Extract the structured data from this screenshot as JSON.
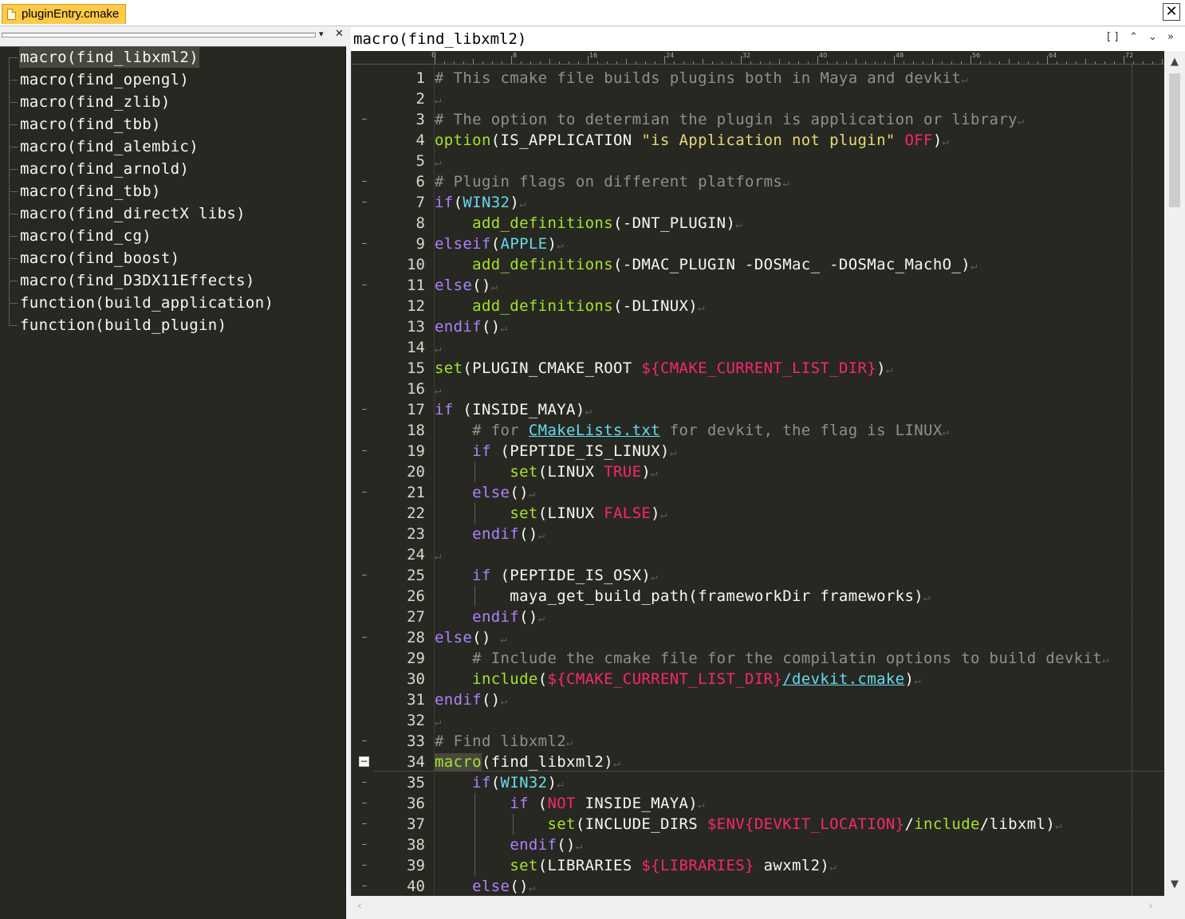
{
  "tab": {
    "label": "pluginEntry.cmake",
    "close_label": "✕"
  },
  "outline": {
    "dropdown_label": "▾",
    "close_label": "✕",
    "items": [
      "macro(find_libxml2)",
      "macro(find_opengl)",
      "macro(find_zlib)",
      "macro(find_tbb)",
      "macro(find_alembic)",
      "macro(find_arnold)",
      "macro(find_tbb)",
      "macro(find_directX libs)",
      "macro(find_cg)",
      "macro(find_boost)",
      "macro(find_D3DX11Effects)",
      "function(build_application)",
      "function(build_plugin)"
    ],
    "selected_index": 0
  },
  "editor": {
    "title": "macro(find_libxml2)",
    "buttons": {
      "maximize": "[ ]",
      "prev": "⌃",
      "next": "⌄",
      "more": "»"
    },
    "ruler": {
      "start": "0",
      "marks": [
        "8",
        "16",
        "24",
        "32",
        "40",
        "48",
        "56",
        "64",
        "72"
      ]
    },
    "current_line": 34,
    "lines": [
      {
        "n": "1",
        "fold": "",
        "segs": [
          [
            "c-cm",
            "# This cmake file builds plugins both in Maya and devkit"
          ]
        ]
      },
      {
        "n": "2",
        "fold": "",
        "segs": []
      },
      {
        "n": "3",
        "fold": "–",
        "segs": [
          [
            "c-cm",
            "# The option to determian the plugin is application or library"
          ]
        ]
      },
      {
        "n": "4",
        "fold": "",
        "segs": [
          [
            "c-fn",
            "option"
          ],
          [
            "",
            "(IS_APPLICATION "
          ],
          [
            "c-str",
            "\"is Application not plugin\""
          ],
          [
            "",
            " "
          ],
          [
            "c-vr",
            "OFF"
          ],
          [
            "",
            ")"
          ]
        ]
      },
      {
        "n": "5",
        "fold": "",
        "segs": []
      },
      {
        "n": "6",
        "fold": "–",
        "segs": [
          [
            "c-cm",
            "# Plugin flags on different platforms"
          ]
        ]
      },
      {
        "n": "7",
        "fold": "–",
        "segs": [
          [
            "c-kw",
            "if"
          ],
          [
            "",
            "("
          ],
          [
            "c-bl",
            "WIN32"
          ],
          [
            "",
            ")"
          ]
        ]
      },
      {
        "n": "8",
        "fold": "",
        "segs": [
          [
            "",
            "    "
          ],
          [
            "c-fn",
            "add_definitions"
          ],
          [
            "",
            "(-DNT_PLUGIN)"
          ]
        ]
      },
      {
        "n": "9",
        "fold": "–",
        "segs": [
          [
            "c-kw",
            "elseif"
          ],
          [
            "",
            "("
          ],
          [
            "c-bl",
            "APPLE"
          ],
          [
            "",
            ")"
          ]
        ]
      },
      {
        "n": "10",
        "fold": "",
        "segs": [
          [
            "",
            "    "
          ],
          [
            "c-fn",
            "add_definitions"
          ],
          [
            "",
            "(-DMAC_PLUGIN -DOSMac_ -DOSMac_MachO_)"
          ]
        ]
      },
      {
        "n": "11",
        "fold": "–",
        "segs": [
          [
            "c-kw",
            "else"
          ],
          [
            "",
            "()"
          ]
        ]
      },
      {
        "n": "12",
        "fold": "",
        "segs": [
          [
            "",
            "    "
          ],
          [
            "c-fn",
            "add_definitions"
          ],
          [
            "",
            "(-DLINUX)"
          ]
        ]
      },
      {
        "n": "13",
        "fold": "",
        "segs": [
          [
            "c-kw",
            "endif"
          ],
          [
            "",
            "()"
          ]
        ]
      },
      {
        "n": "14",
        "fold": "",
        "segs": []
      },
      {
        "n": "15",
        "fold": "",
        "segs": [
          [
            "c-fn",
            "set"
          ],
          [
            "",
            "(PLUGIN_CMAKE_ROOT "
          ],
          [
            "c-vr",
            "${CMAKE_CURRENT_LIST_DIR}"
          ],
          [
            "",
            ")"
          ]
        ]
      },
      {
        "n": "16",
        "fold": "",
        "segs": []
      },
      {
        "n": "17",
        "fold": "–",
        "segs": [
          [
            "c-kw",
            "if"
          ],
          [
            "",
            " (INSIDE_MAYA)"
          ]
        ]
      },
      {
        "n": "18",
        "fold": "",
        "segs": [
          [
            "",
            "    "
          ],
          [
            "c-cm",
            "# for "
          ],
          [
            "c-bl u",
            "CMakeLists.txt"
          ],
          [
            "c-cm",
            " for devkit, the flag is LINUX"
          ]
        ]
      },
      {
        "n": "19",
        "fold": "–",
        "segs": [
          [
            "",
            "    "
          ],
          [
            "c-kw",
            "if"
          ],
          [
            "",
            " (PEPTIDE_IS_LINUX)"
          ]
        ]
      },
      {
        "n": "20",
        "fold": "",
        "segs": [
          [
            "",
            "        "
          ],
          [
            "c-fn",
            "set"
          ],
          [
            "",
            "(LINUX "
          ],
          [
            "c-vr",
            "TRUE"
          ],
          [
            "",
            ")"
          ]
        ]
      },
      {
        "n": "21",
        "fold": "–",
        "segs": [
          [
            "",
            "    "
          ],
          [
            "c-kw",
            "else"
          ],
          [
            "",
            "()"
          ]
        ]
      },
      {
        "n": "22",
        "fold": "",
        "segs": [
          [
            "",
            "        "
          ],
          [
            "c-fn",
            "set"
          ],
          [
            "",
            "(LINUX "
          ],
          [
            "c-vr",
            "FALSE"
          ],
          [
            "",
            ")"
          ]
        ]
      },
      {
        "n": "23",
        "fold": "",
        "segs": [
          [
            "",
            "    "
          ],
          [
            "c-kw",
            "endif"
          ],
          [
            "",
            "()"
          ]
        ]
      },
      {
        "n": "24",
        "fold": "",
        "segs": []
      },
      {
        "n": "25",
        "fold": "–",
        "segs": [
          [
            "",
            "    "
          ],
          [
            "c-kw",
            "if"
          ],
          [
            "",
            " (PEPTIDE_IS_OSX)"
          ]
        ]
      },
      {
        "n": "26",
        "fold": "",
        "segs": [
          [
            "",
            "        maya_get_build_path(frameworkDir frameworks)"
          ]
        ]
      },
      {
        "n": "27",
        "fold": "",
        "segs": [
          [
            "",
            "    "
          ],
          [
            "c-kw",
            "endif"
          ],
          [
            "",
            "()"
          ]
        ]
      },
      {
        "n": "28",
        "fold": "–",
        "segs": [
          [
            "c-kw",
            "else"
          ],
          [
            "",
            "() "
          ]
        ]
      },
      {
        "n": "29",
        "fold": "",
        "segs": [
          [
            "",
            "    "
          ],
          [
            "c-cm",
            "# Include the cmake file for the compilatin options to build devkit"
          ]
        ]
      },
      {
        "n": "30",
        "fold": "",
        "segs": [
          [
            "",
            "    "
          ],
          [
            "c-fn",
            "include"
          ],
          [
            "",
            "("
          ],
          [
            "c-vr",
            "${CMAKE_CURRENT_LIST_DIR}"
          ],
          [
            "c-bl u",
            "/devkit.cmake"
          ],
          [
            "",
            ")"
          ]
        ]
      },
      {
        "n": "31",
        "fold": "",
        "segs": [
          [
            "c-kw",
            "endif"
          ],
          [
            "",
            "()"
          ]
        ]
      },
      {
        "n": "32",
        "fold": "",
        "segs": []
      },
      {
        "n": "33",
        "fold": "–",
        "segs": [
          [
            "c-cm",
            "# Find libxml2"
          ]
        ]
      },
      {
        "n": "34",
        "fold": "box",
        "segs": [
          [
            "c-fn caret-box",
            "macro"
          ],
          [
            "",
            "(find_libxml2)"
          ]
        ]
      },
      {
        "n": "35",
        "fold": "–",
        "segs": [
          [
            "",
            "    "
          ],
          [
            "c-kw",
            "if"
          ],
          [
            "",
            "("
          ],
          [
            "c-bl",
            "WIN32"
          ],
          [
            "",
            ")"
          ]
        ]
      },
      {
        "n": "36",
        "fold": "–",
        "segs": [
          [
            "",
            "        "
          ],
          [
            "c-kw",
            "if"
          ],
          [
            "",
            " ("
          ],
          [
            "c-vr",
            "NOT"
          ],
          [
            "",
            " INSIDE_MAYA)"
          ]
        ]
      },
      {
        "n": "37",
        "fold": "–",
        "segs": [
          [
            "",
            "            "
          ],
          [
            "c-fn",
            "set"
          ],
          [
            "",
            "(INCLUDE_DIRS "
          ],
          [
            "c-vr",
            "$ENV{DEVKIT_LOCATION}"
          ],
          [
            "",
            "/"
          ],
          [
            "c-fn",
            "include"
          ],
          [
            "",
            "/libxml)"
          ]
        ]
      },
      {
        "n": "38",
        "fold": "–",
        "segs": [
          [
            "",
            "        "
          ],
          [
            "c-kw",
            "endif"
          ],
          [
            "",
            "()"
          ]
        ]
      },
      {
        "n": "39",
        "fold": "–",
        "segs": [
          [
            "",
            "        "
          ],
          [
            "c-fn",
            "set"
          ],
          [
            "",
            "(LIBRARIES "
          ],
          [
            "c-vr",
            "${LIBRARIES}"
          ],
          [
            "",
            " awxml2)"
          ]
        ]
      },
      {
        "n": "40",
        "fold": "–",
        "segs": [
          [
            "",
            "    "
          ],
          [
            "c-kw",
            "else"
          ],
          [
            "",
            "()"
          ]
        ]
      }
    ]
  },
  "scrollbars": {
    "up": "▲",
    "down": "▼",
    "left": "‹",
    "right": "›"
  }
}
